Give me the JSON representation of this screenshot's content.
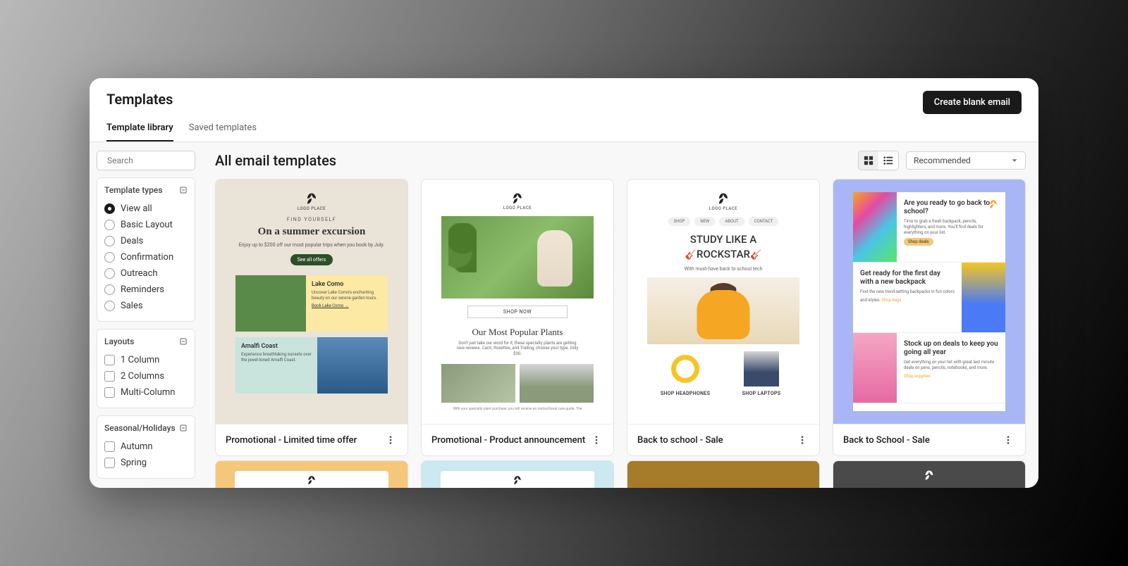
{
  "header": {
    "title": "Templates",
    "create_btn": "Create blank email"
  },
  "tabs": [
    {
      "label": "Template library",
      "active": true
    },
    {
      "label": "Saved templates",
      "active": false
    }
  ],
  "search": {
    "placeholder": "Search"
  },
  "filters": {
    "types": {
      "title": "Template types",
      "items": [
        "View all",
        "Basic Layout",
        "Deals",
        "Confirmation",
        "Outreach",
        "Reminders",
        "Sales"
      ],
      "selected": 0
    },
    "layouts": {
      "title": "Layouts",
      "items": [
        "1 Column",
        "2 Columns",
        "Multi-Column"
      ]
    },
    "seasonal": {
      "title": "Seasonal/Holidays",
      "items": [
        "Autumn",
        "Spring"
      ]
    }
  },
  "main": {
    "title": "All email templates",
    "sort": "Recommended"
  },
  "cards": [
    {
      "title": "Promotional - Limited time offer",
      "pv": {
        "logo": "LOGO PLACE",
        "tagline": "FIND YOURSELF",
        "heading": "On a summer excursion",
        "desc": "Enjoy up to $200 off our most popular trips when you book by July.",
        "cta": "See all offers",
        "rowA": {
          "title": "Lake Como",
          "desc": "Uncover Lake Como's enchanting beauty on our serene garden tours.",
          "link": "Book Lake Como →"
        },
        "rowB": {
          "title": "Amalfi Coast",
          "desc": "Experience breathtaking sunsets over the jewel-toned Amalfi Coast."
        }
      }
    },
    {
      "title": "Promotional - Product announcement",
      "pv": {
        "logo": "LOGO PLACE",
        "cta": "SHOP NOW",
        "heading": "Our Most Popular Plants",
        "desc": "Don't just take our word for it, these specialty plants are getting rave reviews. Cacti, Rosettes, and Trailing, choose your type. Only $30.",
        "foot": "With your specialty plant purchase, you will receive an instructional care guide. The"
      }
    },
    {
      "title": "Back to school - Sale",
      "pv": {
        "logo": "LOGO PLACE",
        "nav": [
          "SHOP",
          "NEW",
          "ABOUT",
          "CONTACT"
        ],
        "line1": "STUDY LIKE A",
        "line2": "ROCKSTAR",
        "desc": "With must-have back to school tech",
        "p1": "SHOP HEADPHONES",
        "p2": "SHOP LAPTOPS"
      }
    },
    {
      "title": "Back to School - Sale",
      "pv": {
        "logo": "LOGO PLACE",
        "s1": {
          "h": "Are you ready to go back to school?",
          "d": "Time to grab a fresh backpack, pencils, highlighters, and more. You'll find deals for everything on your list.",
          "l": "Shop deals"
        },
        "s2": {
          "h": "Get ready for the first day with a new backpack",
          "d": "Find the new trend-setting backpacks in fun colors and styles.",
          "l": "Shop bags"
        },
        "s3": {
          "h": "Stock up on deals to keep you going all year",
          "d": "Get everything on your list with great last minute deals on pens, pencils, notebooks, and more.",
          "l": "Shop supplies"
        }
      }
    }
  ],
  "row2_colors": [
    "#f5c77a",
    "#cce8f0",
    "#a67c2a",
    "#4a4a4a"
  ]
}
